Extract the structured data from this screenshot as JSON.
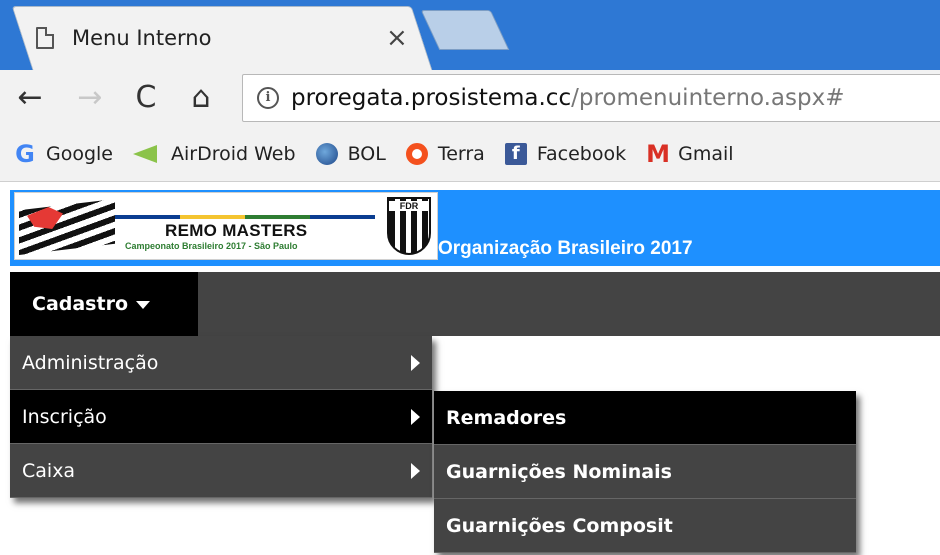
{
  "browser": {
    "tab": {
      "title": "Menu Interno",
      "close_glyph": "×"
    },
    "nav": {
      "back": "←",
      "forward": "→",
      "reload": "C",
      "home": "⌂"
    },
    "url": {
      "host": "proregata.prosistema.cc",
      "path": "/promenuinterno.aspx#"
    },
    "bookmarks": [
      {
        "label": "Google",
        "icon": "google-icon"
      },
      {
        "label": "AirDroid Web",
        "icon": "airdroid-icon"
      },
      {
        "label": "BOL",
        "icon": "bol-icon"
      },
      {
        "label": "Terra",
        "icon": "terra-icon"
      },
      {
        "label": "Facebook",
        "icon": "facebook-icon"
      },
      {
        "label": "Gmail",
        "icon": "gmail-icon"
      }
    ]
  },
  "header": {
    "logo": {
      "title": "REMO MASTERS",
      "subtitle": "Campeonato Brasileiro 2017 - São Paulo",
      "badge": "FDR"
    },
    "org_title": "Organização Brasileiro 2017"
  },
  "menu": {
    "top": "Cadastro",
    "items": [
      {
        "label": "Administração"
      },
      {
        "label": "Inscrição"
      },
      {
        "label": "Caixa"
      }
    ],
    "submenu": [
      {
        "label": "Remadores"
      },
      {
        "label": "Guarnições Nominais"
      },
      {
        "label": "Guarnições Composit"
      }
    ]
  },
  "colors": {
    "header_blue": "#1e90ff",
    "menu_bg": "#444444",
    "menu_active": "#000000",
    "tab_strip": "#2e78d4"
  }
}
